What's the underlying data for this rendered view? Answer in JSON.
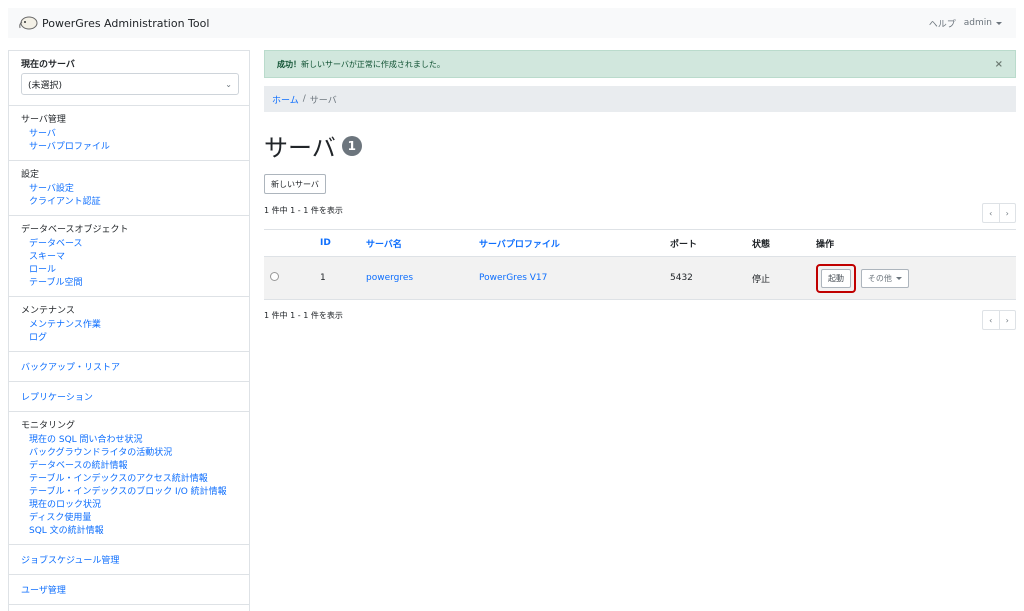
{
  "navbar": {
    "brand": "PowerGres Administration Tool",
    "help": "ヘルプ",
    "user": "admin"
  },
  "sidebar": {
    "current_server_title": "現在のサーバ",
    "current_server_value": "(未選択)",
    "sections": [
      {
        "title": "サーバ管理",
        "items": [
          "サーバ",
          "サーバプロファイル"
        ]
      },
      {
        "title": "設定",
        "items": [
          "サーバ設定",
          "クライアント認証"
        ]
      },
      {
        "title": "データベースオブジェクト",
        "items": [
          "データベース",
          "スキーマ",
          "ロール",
          "テーブル空間"
        ]
      },
      {
        "title": "メンテナンス",
        "items": [
          "メンテナンス作業",
          "ログ"
        ]
      }
    ],
    "link_sections": [
      "バックアップ・リストア",
      "レプリケーション"
    ],
    "monitoring": {
      "title": "モニタリング",
      "items": [
        "現在の SQL 問い合わせ状況",
        "バックグラウンドライタの活動状況",
        "データベースの統計情報",
        "テーブル・インデックスのアクセス統計情報",
        "テーブル・インデックスのブロック I/O 統計情報",
        "現在のロック状況",
        "ディスク使用量",
        "SQL 文の統計情報"
      ]
    },
    "bottom_links": [
      "ジョブスケジュール管理",
      "ユーザ管理"
    ]
  },
  "alert": {
    "strong": "成功！",
    "message": "新しいサーバが正常に作成されました。",
    "close": "×"
  },
  "breadcrumb": {
    "home": "ホーム",
    "separator": "/",
    "current": "サーバ"
  },
  "page": {
    "title": "サーバ",
    "count": "1",
    "new_button": "新しいサーバ",
    "summary": "1 件中 1 - 1 件を表示"
  },
  "pager": {
    "prev": "‹",
    "next": "›"
  },
  "table": {
    "headers": {
      "id": "ID",
      "name": "サーバ名",
      "profile": "サーバプロファイル",
      "port": "ポート",
      "status": "状態",
      "actions": "操作"
    },
    "row": {
      "id": "1",
      "name": "powergres",
      "profile": "PowerGres V17",
      "port": "5432",
      "status": "停止",
      "start": "起動",
      "other": "その他"
    }
  },
  "colors": {
    "highlight": "#c00000",
    "link": "#0d6efd",
    "success_bg": "#d1e7dd"
  }
}
